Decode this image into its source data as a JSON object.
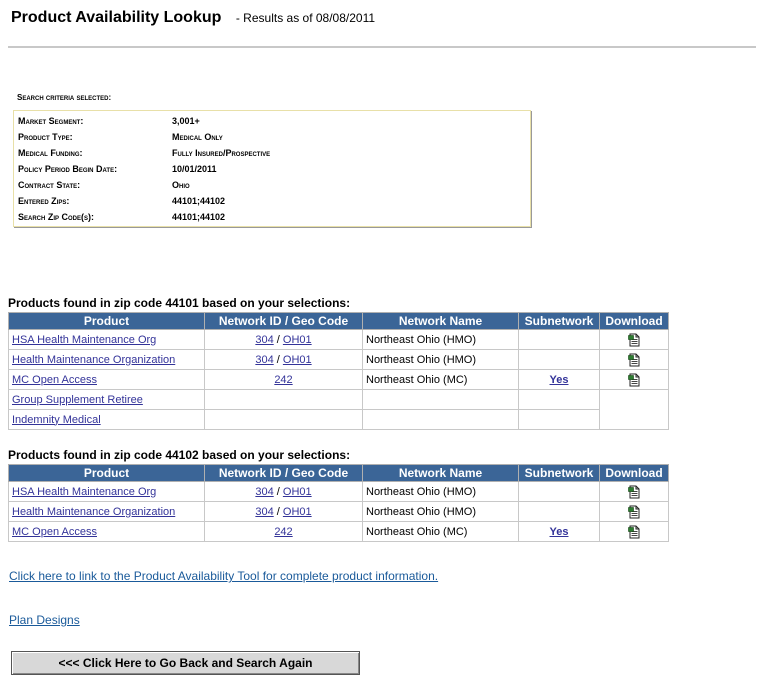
{
  "header": {
    "title": "Product Availability Lookup",
    "subtitle": "- Results as of  08/08/2011"
  },
  "criteria": {
    "title": "Search criteria selected:",
    "rows": [
      {
        "label": "Market Segment:",
        "value": "3,001+"
      },
      {
        "label": "Product Type:",
        "value": "Medical Only"
      },
      {
        "label": "Medical Funding:",
        "value": "Fully Insured/Prospective"
      },
      {
        "label": "Policy Period Begin Date:",
        "value": "10/01/2011"
      },
      {
        "label": "Contract State:",
        "value": "Ohio"
      },
      {
        "label": "Entered Zips:",
        "value": "44101;44102"
      },
      {
        "label": "Search Zip Code(s):",
        "value": "44101;44102"
      }
    ]
  },
  "columns": [
    "Product",
    "Network ID / Geo Code",
    "Network Name",
    "Subnetwork",
    "Download"
  ],
  "section1": {
    "title": "Products found in zip code 44101 based on your selections:",
    "rows": [
      {
        "product": "HSA Health Maintenance Org",
        "network_id": "304",
        "geo": "OH01",
        "network_name": "Northeast Ohio (HMO)",
        "subnetwork": "",
        "download": true
      },
      {
        "product": "Health Maintenance Organization",
        "network_id": "304",
        "geo": "OH01",
        "network_name": "Northeast Ohio (HMO)",
        "subnetwork": "",
        "download": true
      },
      {
        "product": "MC Open Access",
        "network_id": "242",
        "geo": "",
        "network_name": "Northeast Ohio (MC)",
        "subnetwork": "Yes",
        "download": true
      },
      {
        "product": "Group Supplement Retiree",
        "network_id": "",
        "geo": "",
        "network_name": "",
        "subnetwork": "",
        "download": false
      },
      {
        "product": "Indemnity Medical",
        "network_id": "",
        "geo": "",
        "network_name": "",
        "subnetwork": "",
        "download": false
      }
    ]
  },
  "section2": {
    "title": "Products found in zip code 44102 based on your selections:",
    "rows": [
      {
        "product": "HSA Health Maintenance Org",
        "network_id": "304",
        "geo": "OH01",
        "network_name": "Northeast Ohio (HMO)",
        "subnetwork": "",
        "download": true
      },
      {
        "product": "Health Maintenance Organization",
        "network_id": "304",
        "geo": "OH01",
        "network_name": "Northeast Ohio (HMO)",
        "subnetwork": "",
        "download": true
      },
      {
        "product": "MC Open Access",
        "network_id": "242",
        "geo": "",
        "network_name": "Northeast Ohio (MC)",
        "subnetwork": "Yes",
        "download": true
      }
    ]
  },
  "links": {
    "product_tool": "Click here to link to the Product Availability Tool for complete product information.",
    "plan_designs": "Plan Designs"
  },
  "back_button": "<<< Click Here to Go Back and Search Again",
  "icons": {
    "download": "download-document-icon"
  },
  "colors": {
    "table_header": "#3b6597",
    "link": "#333399",
    "bottom_link": "#1a5a9a"
  }
}
